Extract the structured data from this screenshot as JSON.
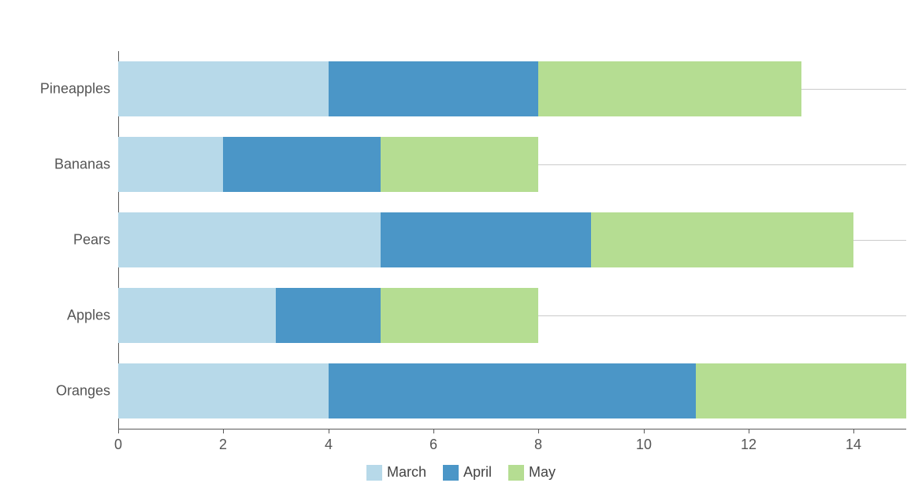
{
  "chart_data": {
    "type": "bar",
    "orientation": "horizontal",
    "stacked": true,
    "categories": [
      "Pineapples",
      "Bananas",
      "Pears",
      "Apples",
      "Oranges"
    ],
    "series": [
      {
        "name": "March",
        "color": "#b7d9e9",
        "values": [
          4,
          2,
          5,
          3,
          4
        ]
      },
      {
        "name": "April",
        "color": "#4b96c7",
        "values": [
          4,
          3,
          4,
          2,
          7
        ]
      },
      {
        "name": "May",
        "color": "#b5dd92",
        "values": [
          5,
          3,
          5,
          3,
          4
        ]
      }
    ],
    "xlabel": "",
    "ylabel": "",
    "xlim": [
      0,
      15
    ],
    "xticks": [
      0,
      2,
      4,
      6,
      8,
      10,
      12,
      14
    ],
    "grid": true,
    "legend_position": "bottom"
  }
}
